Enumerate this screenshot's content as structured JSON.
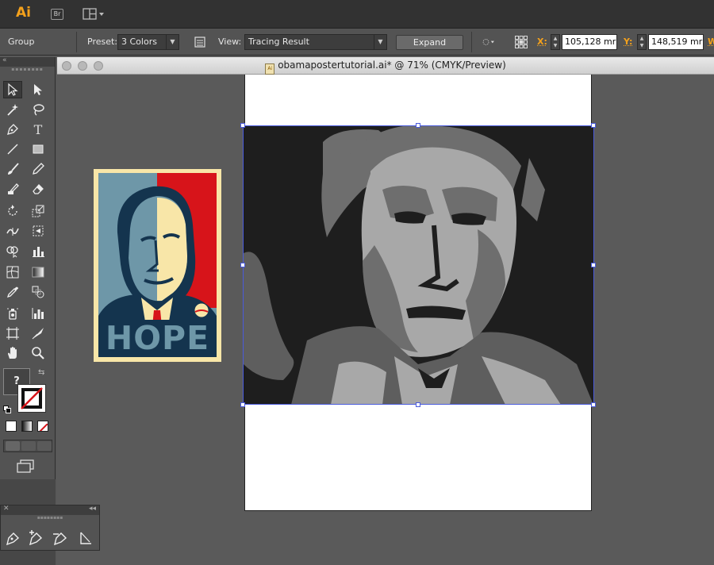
{
  "appbar": {
    "logo": "Ai",
    "bridge_label": "Br"
  },
  "controlbar": {
    "selection_label": "Group",
    "preset_label": "Preset:",
    "preset_value": "3 Colors",
    "view_label": "View:",
    "view_value": "Tracing Result",
    "expand_label": "Expand",
    "x_label": "X:",
    "x_value": "105,128 mr",
    "y_label": "Y:",
    "y_value": "148,519 mr",
    "w_label": "W"
  },
  "document": {
    "title": "obamapostertutorial.ai* @ 71% (CMYK/Preview)",
    "file_icon_label": "Ai"
  },
  "poster": {
    "text": "HOPE"
  },
  "tools": {
    "type_tool_glyph": "T",
    "unknown_fill_glyph": "?"
  },
  "colors": {
    "accent": "#f4a11c",
    "selection": "#4a5bdc",
    "poster_red": "#d7141a",
    "poster_blue": "#6e97a8",
    "poster_navy": "#14344e",
    "poster_cream": "#f8e6a8",
    "trace_dark": "#1e1e1e",
    "trace_mid": "#6e6e6e",
    "trace_light": "#a8a8a8"
  }
}
